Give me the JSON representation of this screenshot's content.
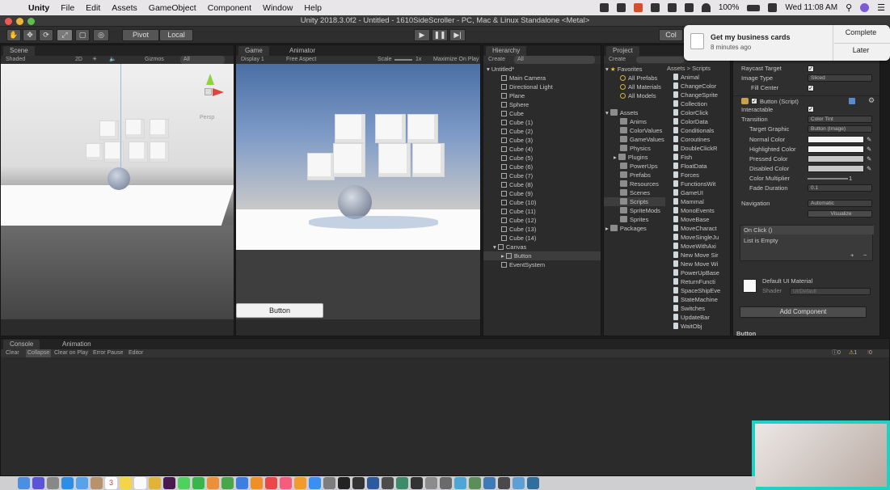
{
  "menubar": {
    "app": "Unity",
    "items": [
      "File",
      "Edit",
      "Assets",
      "GameObject",
      "Component",
      "Window",
      "Help"
    ],
    "battery": "100%",
    "clock": "Wed 11:08 AM"
  },
  "window": {
    "title": "Unity 2018.3.0f2 - Untitled - 1610SideScroller - PC, Mac & Linux Standalone <Metal>"
  },
  "toolbar": {
    "pivot": "Pivot",
    "local": "Local",
    "collab": "Col"
  },
  "scene": {
    "tab": "Scene",
    "shading": "Shaded",
    "mode_2d": "2D",
    "gizmos": "Gizmos",
    "search": "All",
    "persp": "Persp"
  },
  "game": {
    "tab": "Game",
    "tab2": "Animator",
    "display": "Display 1",
    "aspect": "Free Aspect",
    "scale": "Scale",
    "scale_val": "1x",
    "maximize": "Maximize On Play",
    "ui_button": "Button"
  },
  "hierarchy": {
    "tab": "Hierarchy",
    "create": "Create",
    "search": "All",
    "scene": "Untitled*",
    "items": [
      "Main Camera",
      "Directional Light",
      "Plane",
      "Sphere",
      "Cube",
      "Cube (1)",
      "Cube (2)",
      "Cube (3)",
      "Cube (4)",
      "Cube (5)",
      "Cube (6)",
      "Cube (7)",
      "Cube (8)",
      "Cube (9)",
      "Cube (10)",
      "Cube (11)",
      "Cube (12)",
      "Cube (13)",
      "Cube (14)",
      "Canvas",
      "Button",
      "EventSystem"
    ]
  },
  "project": {
    "tab": "Project",
    "create": "Create",
    "favorites": "Favorites",
    "fav_items": [
      "All Prefabs",
      "All Materials",
      "All Models"
    ],
    "assets": "Assets",
    "asset_folders": [
      "Anims",
      "ColorValues",
      "GameValues",
      "Physics",
      "Plugins",
      "PowerUps",
      "Prefabs",
      "Resources",
      "Scenes",
      "Scripts",
      "SpriteMods",
      "Sprites"
    ],
    "packages": "Packages",
    "breadcrumb": [
      "Assets",
      "Scripts"
    ],
    "scripts": [
      "Animal",
      "ChangeColor",
      "ChangeSprite",
      "Collection",
      "ColorClick",
      "ColorData",
      "Conditionals",
      "Coroutines",
      "DoubleClickR",
      "Fish",
      "FloatData",
      "Forces",
      "FunctionsWit",
      "GameUI",
      "Mammal",
      "MonoEvents",
      "MoveBase",
      "MoveCharact",
      "MoveSingleJu",
      "MoveWithAxi",
      "New Move Sir",
      "New Move Wi",
      "PowerUpBase",
      "ReturnFuncti",
      "SpaceShipEve",
      "StateMachine",
      "Switches",
      "UpdateBar",
      "WaitObj"
    ]
  },
  "inspector": {
    "raycast_target": "Raycast Target",
    "image_type": "Image Type",
    "image_type_val": "Sliced",
    "fill_center": "Fill Center",
    "component": "Button (Script)",
    "interactable": "Interactable",
    "transition": "Transition",
    "transition_val": "Color Tint",
    "target_graphic": "Target Graphic",
    "target_graphic_val": "Button (Image)",
    "normal_color": "Normal Color",
    "highlighted_color": "Highlighted Color",
    "pressed_color": "Pressed Color",
    "disabled_color": "Disabled Color",
    "color_multiplier": "Color Multiplier",
    "color_multiplier_val": "1",
    "fade_duration": "Fade Duration",
    "fade_duration_val": "0.1",
    "navigation": "Navigation",
    "navigation_val": "Automatic",
    "visualize": "Visualize",
    "on_click": "On Click ()",
    "list_empty": "List is Empty",
    "material": "Default UI Material",
    "shader": "Shader",
    "shader_val": "UI/Default",
    "add_component": "Add Component",
    "footer": "Button"
  },
  "console": {
    "tab": "Console",
    "tab2": "Animation",
    "buttons": [
      "Clear",
      "Collapse",
      "Clear on Play",
      "Error Pause",
      "Editor"
    ],
    "counts": [
      "0",
      "1",
      "0"
    ]
  },
  "notification": {
    "title": "Get my business cards",
    "time": "8 minutes ago",
    "complete": "Complete",
    "later": "Later"
  },
  "dock": {
    "calendar_day": "3"
  }
}
